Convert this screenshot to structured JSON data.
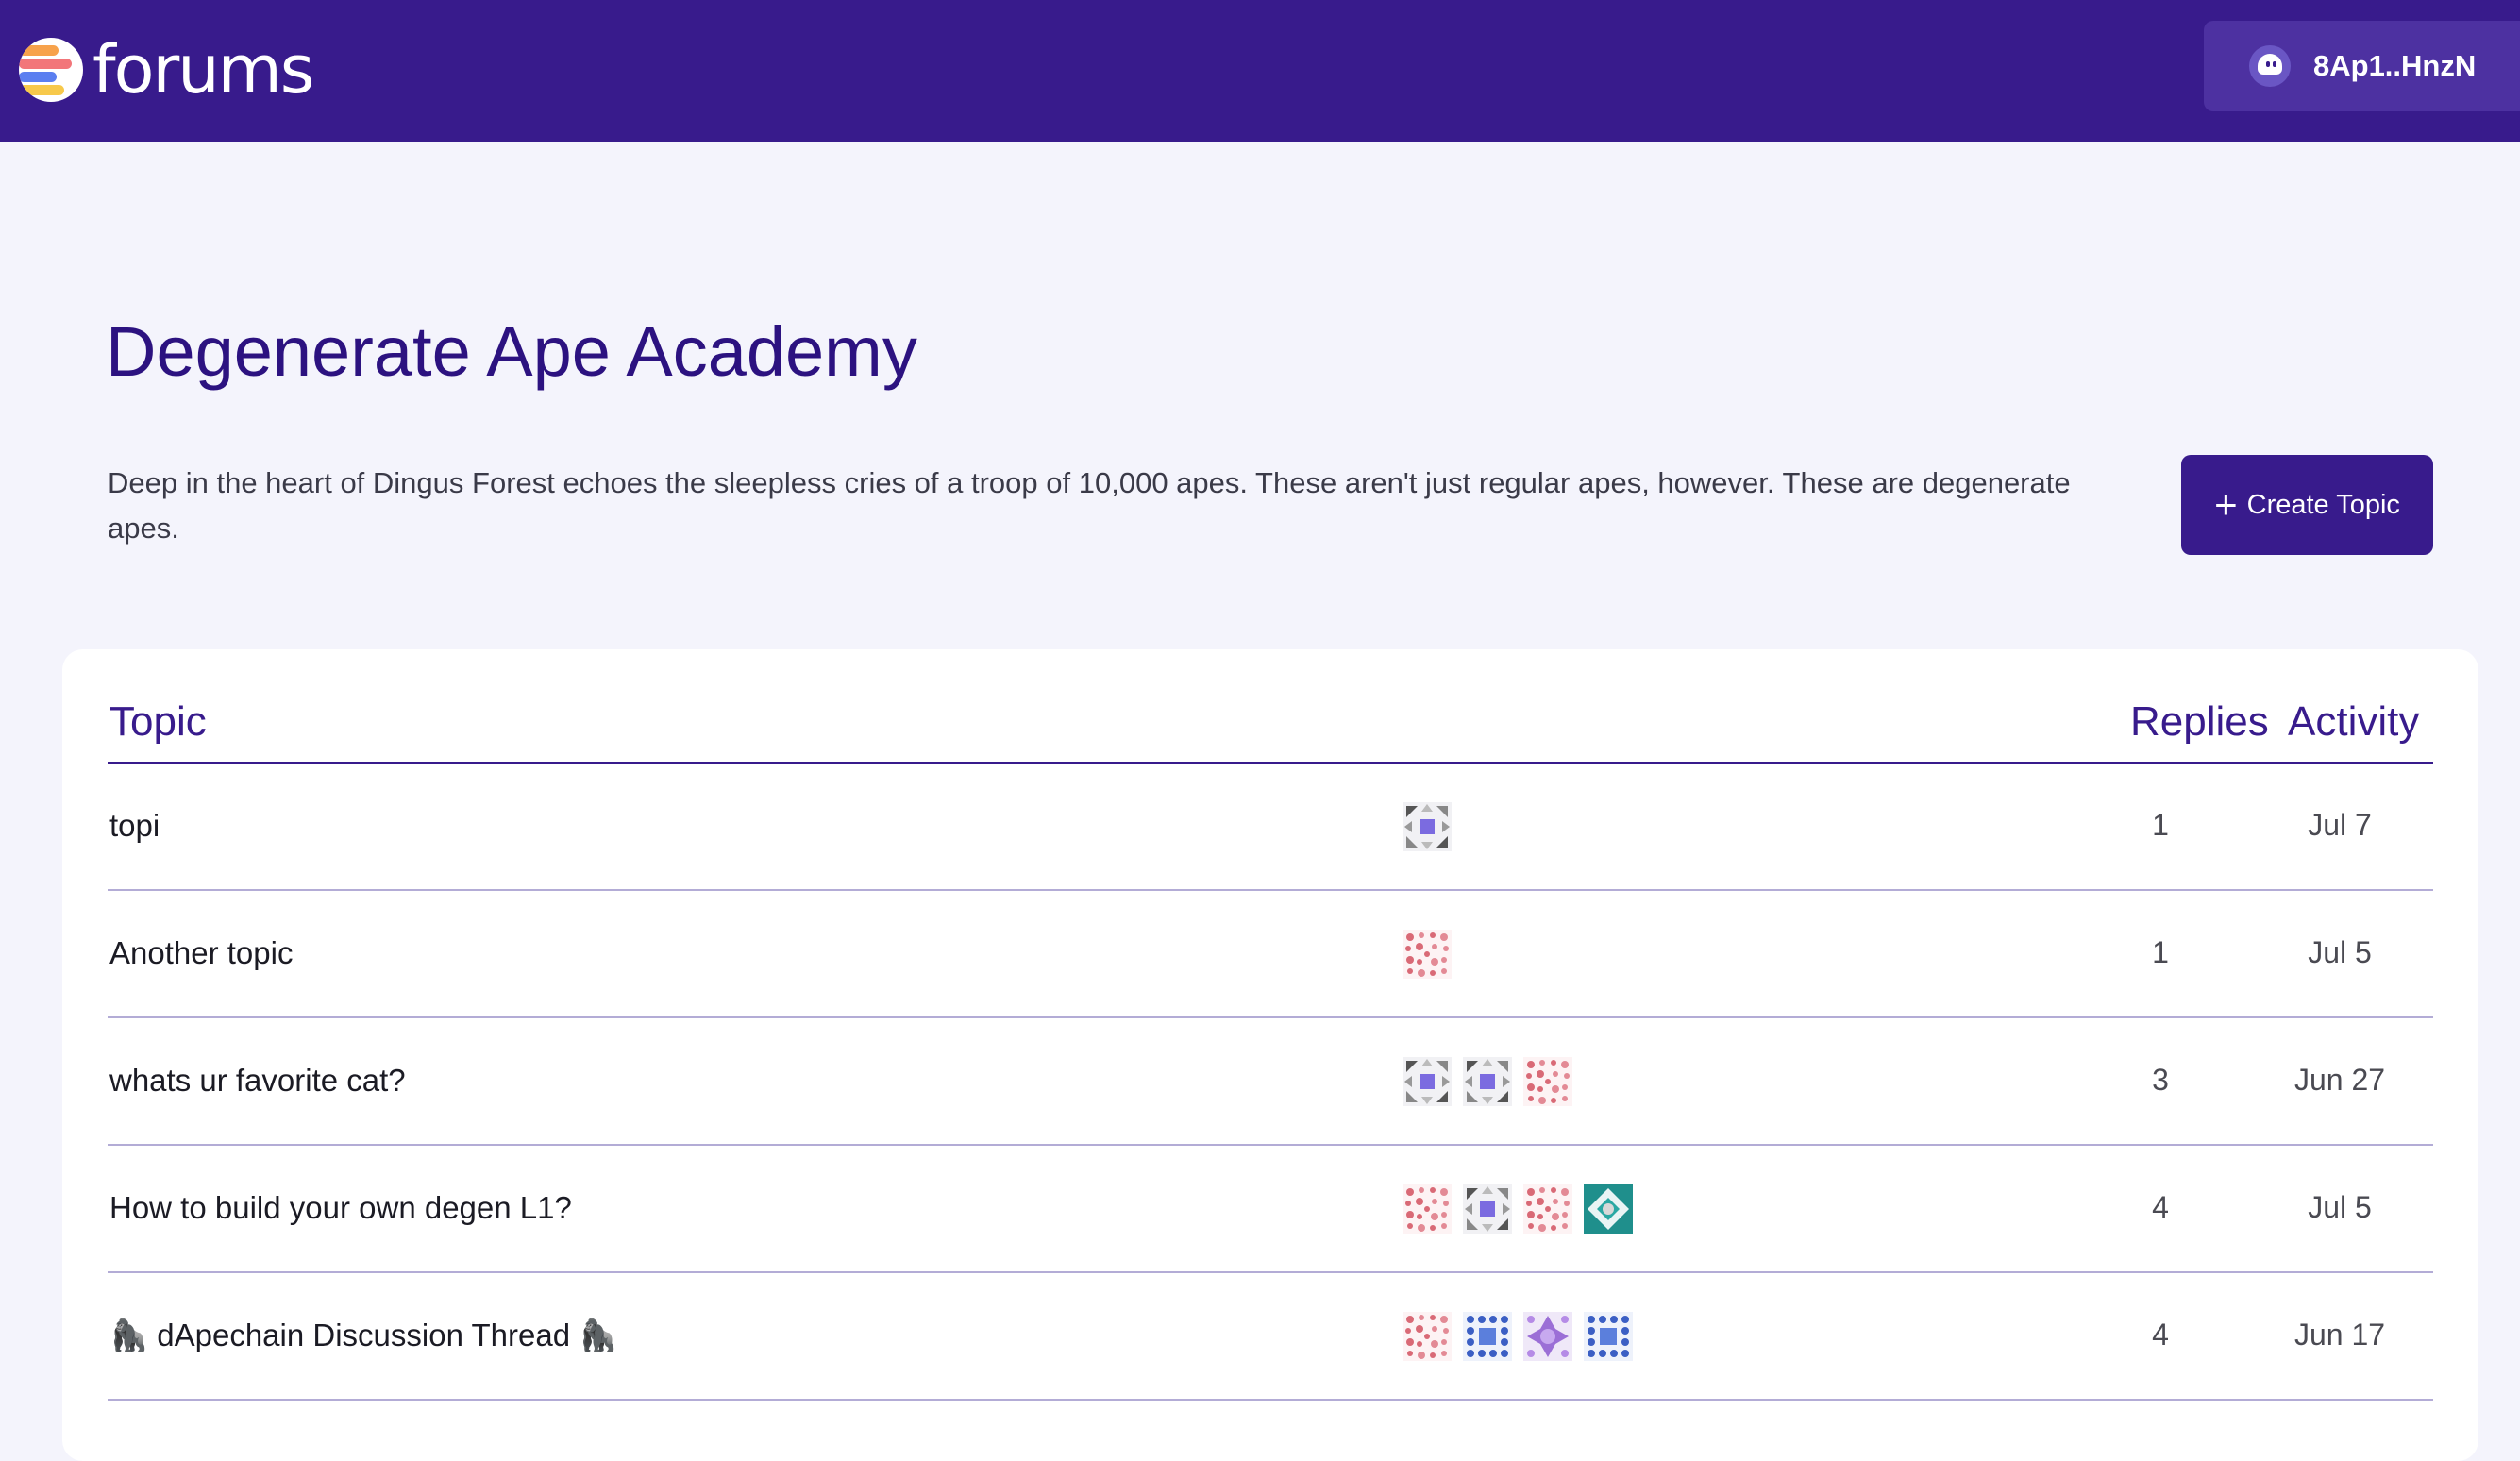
{
  "header": {
    "logo_text": "forums",
    "wallet_label": "8Ap1..HnzN",
    "bg_color": "#381b8c"
  },
  "forum": {
    "title": "Degenerate Ape Academy",
    "description": "Deep in the heart of Dingus Forest echoes the sleepless cries of a troop of 10,000 apes. These aren't just regular apes, however. These are degenerate apes.",
    "create_button": "Create Topic"
  },
  "table": {
    "headers": {
      "topic": "Topic",
      "replies": "Replies",
      "activity": "Activity"
    },
    "rows": [
      {
        "title": "topi",
        "avatars": [
          "grey-purple"
        ],
        "replies": "1",
        "activity": "Jul 7"
      },
      {
        "title": "Another topic",
        "avatars": [
          "red-dots"
        ],
        "replies": "1",
        "activity": "Jul 5"
      },
      {
        "title": "whats ur favorite cat?",
        "avatars": [
          "grey-purple",
          "grey-purple",
          "red-dots"
        ],
        "replies": "3",
        "activity": "Jun 27"
      },
      {
        "title": "How to build your own degen L1?",
        "avatars": [
          "red-dots",
          "grey-purple",
          "red-dots",
          "teal"
        ],
        "replies": "4",
        "activity": "Jul 5"
      },
      {
        "title": "🦍 dApechain Discussion Thread 🦍",
        "avatars": [
          "red-dots",
          "blue-dots",
          "purple-cross",
          "blue-dots"
        ],
        "replies": "4",
        "activity": "Jun 17"
      }
    ]
  }
}
